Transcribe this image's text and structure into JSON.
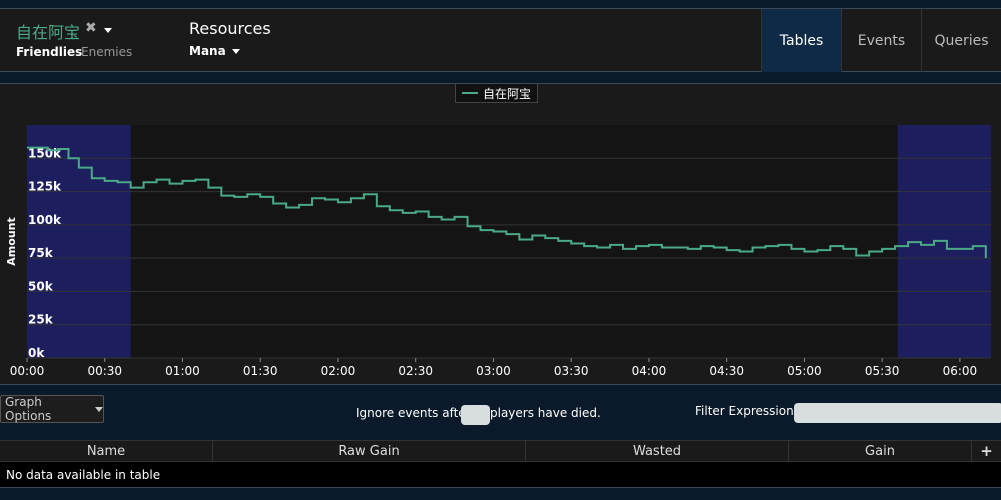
{
  "header": {
    "player_name": "自在阿宝",
    "tabs": {
      "friendlies": "Friendlies",
      "enemies": "Enemies"
    },
    "resources_title": "Resources",
    "resource_type": "Mana",
    "nav": [
      "Tables",
      "Events",
      "Queries"
    ]
  },
  "chart_data": {
    "type": "line",
    "ylabel": "Amount",
    "x_ticks": [
      "00:00",
      "00:30",
      "01:00",
      "01:30",
      "02:00",
      "02:30",
      "03:00",
      "03:30",
      "04:00",
      "04:30",
      "05:00",
      "05:30",
      "06:00"
    ],
    "y_ticks": [
      "0k",
      "25k",
      "50k",
      "75k",
      "100k",
      "125k",
      "150k"
    ],
    "ylim": [
      0,
      175000
    ],
    "xlim_seconds": [
      0,
      372
    ],
    "series": [
      {
        "name": "自在阿宝",
        "color": "#4aaa86",
        "x_seconds": [
          0,
          8,
          12,
          16,
          20,
          25,
          30,
          35,
          40,
          45,
          50,
          55,
          60,
          65,
          70,
          75,
          80,
          85,
          90,
          95,
          100,
          105,
          110,
          115,
          120,
          125,
          130,
          135,
          140,
          145,
          150,
          155,
          160,
          165,
          170,
          175,
          180,
          185,
          190,
          195,
          200,
          205,
          210,
          215,
          220,
          225,
          230,
          235,
          240,
          245,
          250,
          255,
          260,
          265,
          270,
          275,
          280,
          285,
          290,
          295,
          300,
          305,
          310,
          315,
          320,
          325,
          330,
          335,
          340,
          345,
          350,
          355,
          360,
          365,
          370
        ],
        "values": [
          158000,
          156000,
          157000,
          150000,
          143000,
          135000,
          133000,
          132000,
          128000,
          132000,
          134000,
          131000,
          133000,
          134000,
          128000,
          122000,
          121000,
          123000,
          121000,
          116000,
          113000,
          115000,
          120000,
          119000,
          117000,
          120000,
          123000,
          114000,
          111000,
          109000,
          110000,
          106000,
          104000,
          106000,
          99000,
          96000,
          95000,
          93000,
          89000,
          92000,
          90000,
          88000,
          86000,
          84000,
          83000,
          85000,
          82000,
          84000,
          85000,
          83000,
          83000,
          82000,
          84000,
          83000,
          81000,
          80000,
          83000,
          84000,
          85000,
          82000,
          80000,
          81000,
          84000,
          82000,
          77000,
          80000,
          82000,
          84000,
          87000,
          85000,
          88000,
          82000,
          82000,
          84000,
          75000
        ]
      }
    ],
    "highlight_regions_seconds": [
      [
        0,
        40
      ],
      [
        336,
        372
      ]
    ]
  },
  "options": {
    "graph_options_label": "Graph Options",
    "ignore_before": "Ignore events after",
    "ignore_after": "players have died.",
    "filter_label": "Filter Expression:"
  },
  "table": {
    "columns": [
      "Name",
      "Raw Gain",
      "Wasted",
      "Gain"
    ],
    "plus": "+",
    "empty_message": "No data available in table"
  }
}
